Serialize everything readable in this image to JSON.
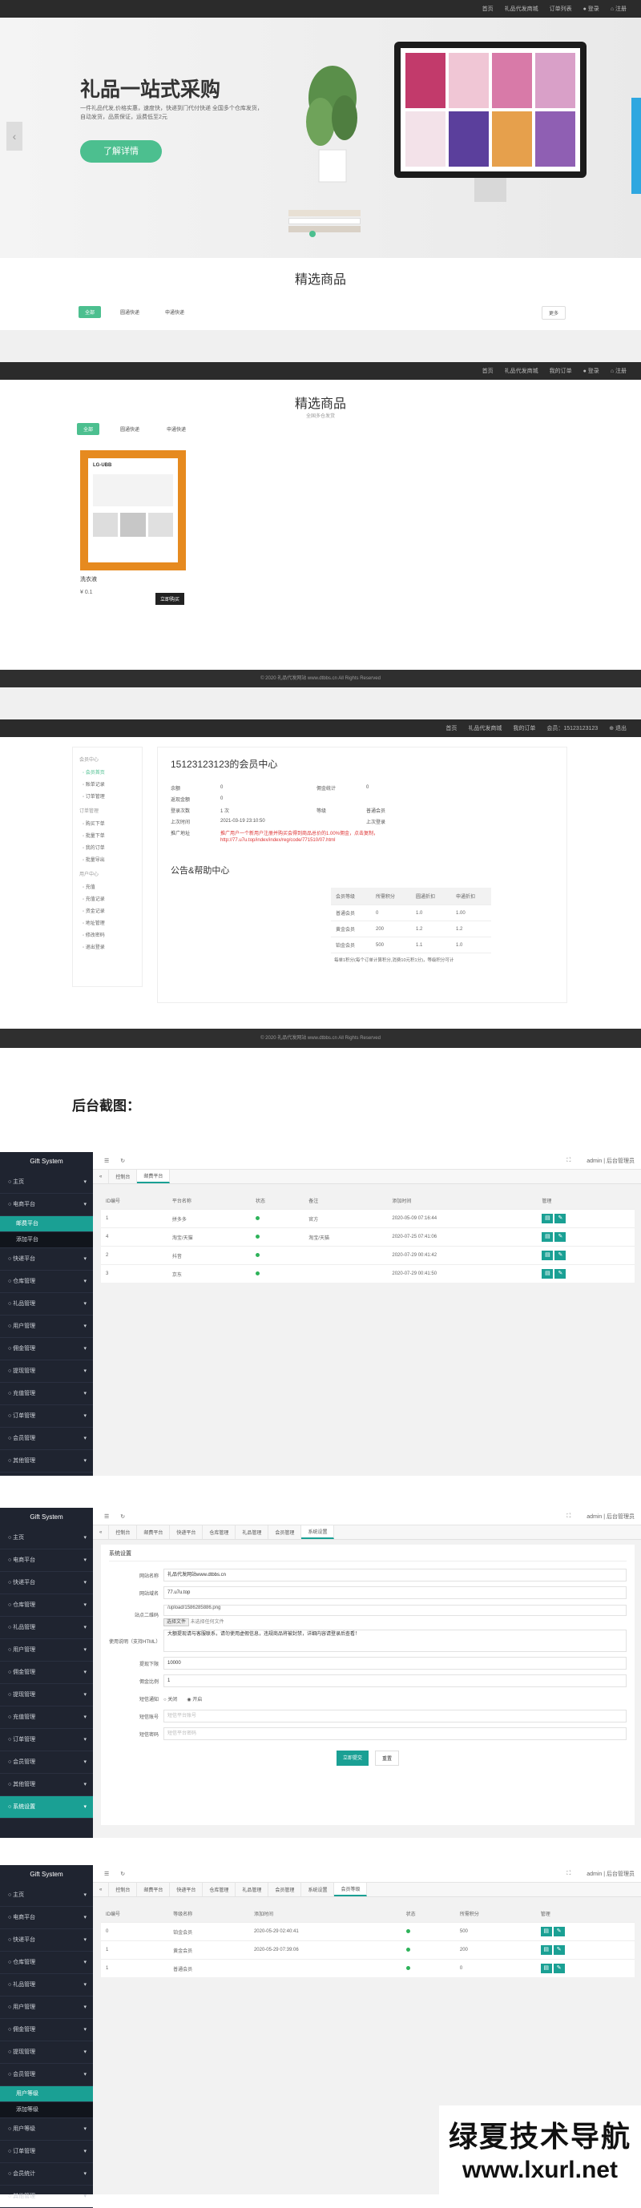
{
  "site1": {
    "topnav": [
      "首页",
      "礼品代发商城",
      "订单列表",
      "● 登录",
      "⌂ 注册"
    ],
    "hero_title": "礼品一站式采购",
    "hero_desc": "一件礼品代发,价格实惠，速度快，快递到门代付快递 全国多个仓库发货，自动发货，品质保证，运费低至2元",
    "hero_button": "了解详情",
    "section_title": "精选商品",
    "tabs": [
      "全部",
      "圆通快递",
      "申通快递"
    ],
    "more": "更多"
  },
  "site2": {
    "topnav": [
      "首页",
      "礼品代发商城",
      "我的订单",
      "● 登录",
      "⌂ 注册"
    ],
    "section_title": "精选商品",
    "section_sub": "全国多仓发货",
    "tabs": [
      "全部",
      "圆通快递",
      "申通快递"
    ],
    "product_name": "洗衣液",
    "product_price": "¥ 0.1",
    "product_button": "立即购买",
    "footer": "© 2020 礼品代发网站 www.dtbbs.cn All Rights Reserved"
  },
  "site3": {
    "topnav": [
      "首页",
      "礼品代发商城",
      "我的订单",
      "会员：15123123123",
      "⊕ 退出"
    ],
    "side_groups": [
      {
        "title": "会员中心",
        "items": [
          "会员首页",
          "账单记录",
          "订单管理"
        ]
      },
      {
        "title": "订单管理",
        "items": [
          "购买下单",
          "批量下单",
          "我的订单",
          "批量导出"
        ]
      },
      {
        "title": "用户中心",
        "items": [
          "充值",
          "充值记录",
          "资金记录",
          "地址管理",
          "修改密码",
          "退出登录"
        ]
      }
    ],
    "member_title": "15123123123的会员中心",
    "fields": [
      {
        "k": "余额",
        "v": "0",
        "k2": "佣金统计",
        "v2": "0"
      },
      {
        "k": "返现金额",
        "v": "0",
        "k2": "",
        "v2": ""
      },
      {
        "k": "登录次数",
        "v": "1 次",
        "k2": "等级",
        "v2": "普通会员"
      },
      {
        "k": "上次时间",
        "v": "2021-03-19 23:10:50",
        "k2": "",
        "v2": "上次登录"
      },
      {
        "k": "推广地址",
        "v": "推广用户一个新用户注册并购买会得到商品总价的1.00%佣金，点击复制，",
        "k2": "",
        "v2": ""
      }
    ],
    "promo_link": "http://77.u7u.top/index/index/reg/code/771510/07.html",
    "notice_title": "公告&帮助中心",
    "level_table": {
      "head": [
        "会员等级",
        "所需积分",
        "圆通折扣",
        "申通折扣"
      ],
      "rows": [
        [
          "普通会员",
          "0",
          "1.0",
          "1.00"
        ],
        [
          "黄金会员",
          "200",
          "1.2",
          "1.2"
        ],
        [
          "铂金会员",
          "500",
          "1.1",
          "1.0"
        ]
      ],
      "note": "每单1积分(每个订单计算积分,消费10元积1分)，等级积分可计"
    },
    "footer": "© 2020 礼品代发网站 www.dtbbs.cn All Rights Reserved"
  },
  "heading": "后台截图：",
  "admin1": {
    "brand": "Gift System",
    "top_user": "admin | 后台管理员",
    "tabs": [
      "控制台",
      "邮费平台"
    ],
    "menu": [
      "主页",
      "电商平台",
      "快递平台",
      "仓库管理",
      "礼品管理",
      "用户管理",
      "佣金管理",
      "提现管理",
      "充值管理",
      "订单管理",
      "会员管理",
      "其他管理"
    ],
    "table_head": [
      "ID编号",
      "平台名称",
      "状态",
      "备注",
      "添加时间",
      "管理"
    ],
    "rows": [
      [
        "1",
        "拼多多",
        "",
        "官方",
        "2020-05-09 07:16:44"
      ],
      [
        "4",
        "淘宝/天猫",
        "",
        "淘宝/天猫",
        "2020-07-25 07:41:06"
      ],
      [
        "2",
        "抖音",
        "",
        "",
        "2020-07-29 00:41:42"
      ],
      [
        "3",
        "京东",
        "",
        "",
        "2020-07-29 00:41:50"
      ]
    ]
  },
  "admin2": {
    "brand": "Gift System",
    "top_user": "admin | 后台管理员",
    "tabs": [
      "控制台",
      "邮费平台",
      "快递平台",
      "仓库管理",
      "礼品管理",
      "会员管理",
      "系统设置"
    ],
    "menu": [
      "主页",
      "电商平台",
      "快递平台",
      "仓库管理",
      "礼品管理",
      "用户管理",
      "佣金管理",
      "提现管理",
      "充值管理",
      "订单管理",
      "会员管理",
      "其他管理",
      "系统设置"
    ],
    "form_title": "系统设置",
    "form": [
      {
        "label": "网站名称",
        "value": "礼品代发网站www.dtbbs.cn"
      },
      {
        "label": "网站域名",
        "value": "77.u7u.top"
      },
      {
        "label": "站点二维码",
        "value": "/upload/1586285886.png"
      },
      {
        "label": "使用说明（支持HTML）",
        "value": "大额提现请与客服联系，请勿使用虚假信息，违规商品将被封禁，详细内容请登录后查看！"
      },
      {
        "label": "提现下限",
        "value": "10000"
      },
      {
        "label": "佣金比例",
        "value": "1"
      },
      {
        "label": "短信通知",
        "value": ""
      },
      {
        "label": "短信账号",
        "value": "短信平台账号"
      },
      {
        "label": "短信密码",
        "value": "短信平台密码"
      }
    ],
    "upload_btn": "选择文件",
    "upload_hint": "未选择任何文件",
    "radio": [
      "关闭",
      "开启"
    ],
    "submit": "立即提交",
    "reset": "重置"
  },
  "admin3": {
    "brand": "Gift System",
    "top_user": "admin | 后台管理员",
    "tabs": [
      "控制台",
      "邮费平台",
      "快递平台",
      "仓库管理",
      "礼品管理",
      "会员管理",
      "系统设置",
      "会员等级"
    ],
    "menu": [
      "主页",
      "电商平台",
      "快递平台",
      "仓库管理",
      "礼品管理",
      "用户管理",
      "佣金管理",
      "提现管理",
      "会员管理",
      "用户等级",
      "订单管理",
      "会员统计",
      "其他管理"
    ],
    "active_sub": "用户等级",
    "table_head": [
      "ID编号",
      "等级名称",
      "添加时间",
      "状态",
      "所需积分",
      "管理"
    ],
    "rows": [
      [
        "0",
        "铂金会员",
        "2020-05-29 02:40:41",
        "",
        "500"
      ],
      [
        "1",
        "黄金会员",
        "2020-05-29 07:39:06",
        "",
        "200"
      ],
      [
        "1",
        "普通会员",
        "",
        "",
        "0"
      ]
    ]
  },
  "watermark": {
    "line1": "绿夏技术导航",
    "line2": "www.lxurl.net"
  },
  "colors": {
    "accent": "#4cbf8f",
    "admin_accent": "#1aa094",
    "dark": "#2b2b2b"
  }
}
